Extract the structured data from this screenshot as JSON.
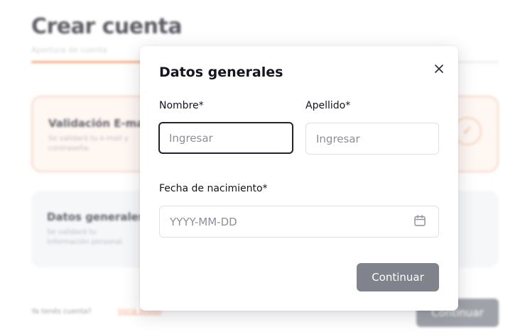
{
  "background": {
    "title": "Crear cuenta",
    "subtitle": "Apertura de cuenta",
    "progress_fraction": 0.25,
    "cards": [
      {
        "title": "Validación E-mail",
        "text": "Se validará tu e-mail y contraseña.",
        "status_icon": "check-icon"
      },
      {
        "title": "Datos generales",
        "text": "Se validará tu información personal."
      }
    ],
    "footer": {
      "prompt": "Ya tenés cuenta?",
      "link": "Iniciá sesión"
    },
    "continue_label": "Continuar"
  },
  "modal": {
    "title": "Datos generales",
    "close_icon": "close-icon",
    "fields": {
      "nombre": {
        "label": "Nombre*",
        "placeholder": "Ingresar",
        "value": ""
      },
      "apellido": {
        "label": "Apellido*",
        "placeholder": "Ingresar",
        "value": ""
      },
      "fecha": {
        "label": "Fecha de nacimiento*",
        "placeholder": "YYYY-MM-DD",
        "value": "",
        "icon": "calendar-icon"
      }
    },
    "continue_label": "Continuar"
  },
  "colors": {
    "accent": "#f28a55",
    "button_disabled": "#80838b",
    "text_primary": "#15151f"
  }
}
